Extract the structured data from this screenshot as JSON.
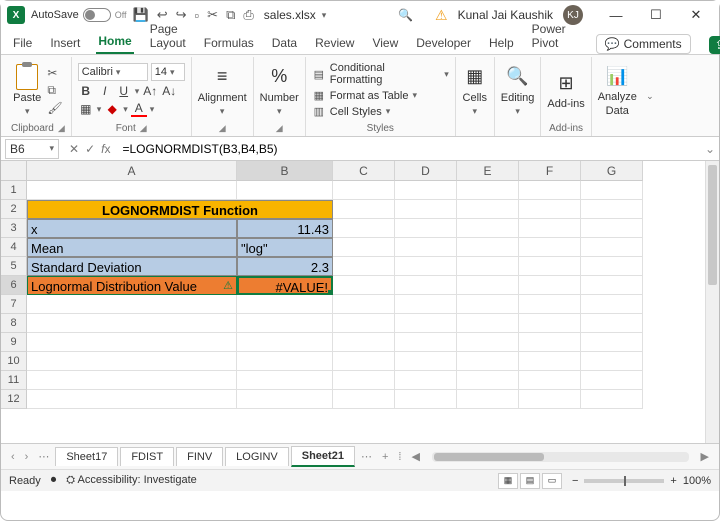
{
  "titlebar": {
    "autosave_label": "AutoSave",
    "autosave_state": "Off",
    "filename": "sales.xlsx",
    "username": "Kunal Jai Kaushik",
    "avatar_initials": "KJ"
  },
  "tabs": {
    "items": [
      "File",
      "Insert",
      "Home",
      "Page Layout",
      "Formulas",
      "Data",
      "Review",
      "View",
      "Developer",
      "Help",
      "Power Pivot"
    ],
    "active": "Home",
    "comments_label": "Comments"
  },
  "ribbon": {
    "clipboard": {
      "paste": "Paste",
      "label": "Clipboard"
    },
    "font": {
      "name": "Calibri",
      "size": "14",
      "label": "Font"
    },
    "alignment": {
      "btn": "Alignment"
    },
    "number": {
      "btn": "Number",
      "symbol": "%"
    },
    "styles": {
      "cond": "Conditional Formatting",
      "table": "Format as Table",
      "cell": "Cell Styles",
      "label": "Styles"
    },
    "cells": {
      "btn": "Cells"
    },
    "editing": {
      "btn": "Editing"
    },
    "addins": {
      "btn": "Add-ins",
      "label": "Add-ins"
    },
    "analyze": {
      "btn1": "Analyze",
      "btn2": "Data"
    }
  },
  "formula_bar": {
    "name_box": "B6",
    "formula": "=LOGNORMDIST(B3,B4,B5)"
  },
  "grid": {
    "columns": [
      "A",
      "B",
      "C",
      "D",
      "E",
      "F",
      "G"
    ],
    "col_widths": {
      "A": 210,
      "B": 96,
      "other": 62
    },
    "rows": [
      "1",
      "2",
      "3",
      "4",
      "5",
      "6",
      "7",
      "8",
      "9",
      "10",
      "11",
      "12"
    ],
    "title": "LOGNORMDIST Function",
    "r3": {
      "a": "x",
      "b": "11.43"
    },
    "r4": {
      "a": "Mean",
      "b": "\"log\""
    },
    "r5": {
      "a": "Standard Deviation",
      "b": "2.3"
    },
    "r6": {
      "a": "Lognormal Distribution Value",
      "b": "#VALUE!"
    },
    "selected_cell": "B6"
  },
  "sheets": {
    "tabs": [
      "Sheet17",
      "FDIST",
      "FINV",
      "LOGINV",
      "Sheet21"
    ],
    "active": "Sheet21"
  },
  "status": {
    "mode": "Ready",
    "accessibility": "Accessibility: Investigate",
    "zoom": "100%"
  }
}
